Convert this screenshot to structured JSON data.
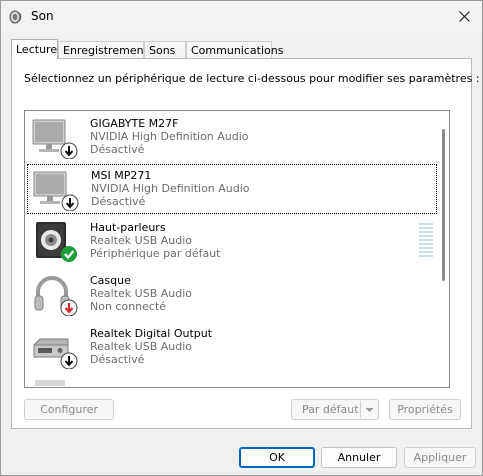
{
  "window": {
    "title": "Son",
    "close_icon": "close-icon",
    "app_icon": "speaker-app-icon"
  },
  "tabs": [
    {
      "label": "Lecture",
      "active": true
    },
    {
      "label": "Enregistrement",
      "active": false
    },
    {
      "label": "Sons",
      "active": false
    },
    {
      "label": "Communications",
      "active": false
    }
  ],
  "instruction": "Sélectionnez un périphérique de lecture ci-dessous pour modifier ses paramètres :",
  "devices": [
    {
      "name": "GIGABYTE M27F",
      "driver": "NVIDIA High Definition Audio",
      "status": "Désactivé",
      "icon": "monitor-icon",
      "badge": "down-arrow-badge",
      "focused": false
    },
    {
      "name": "MSI MP271",
      "driver": "NVIDIA High Definition Audio",
      "status": "Désactivé",
      "icon": "monitor-icon",
      "badge": "down-arrow-badge",
      "focused": true
    },
    {
      "name": "Haut-parleurs",
      "driver": "Realtek USB Audio",
      "status": "Périphérique par défaut",
      "icon": "speaker-icon",
      "badge": "green-check-badge",
      "focused": false
    },
    {
      "name": "Casque",
      "driver": "Realtek USB Audio",
      "status": "Non connecté",
      "icon": "headphones-icon",
      "badge": "red-down-arrow-badge",
      "focused": false
    },
    {
      "name": "Realtek Digital Output",
      "driver": "Realtek USB Audio",
      "status": "Désactivé",
      "icon": "digital-output-icon",
      "badge": "down-arrow-badge",
      "focused": false
    }
  ],
  "buttons": {
    "configure": "Configurer",
    "set_default": "Par défaut",
    "properties": "Propriétés",
    "ok": "OK",
    "cancel": "Annuler",
    "apply": "Appliquer"
  },
  "colors": {
    "check_green": "#1f9f3c",
    "error_red": "#d42b2b",
    "accent": "#0067c0"
  }
}
